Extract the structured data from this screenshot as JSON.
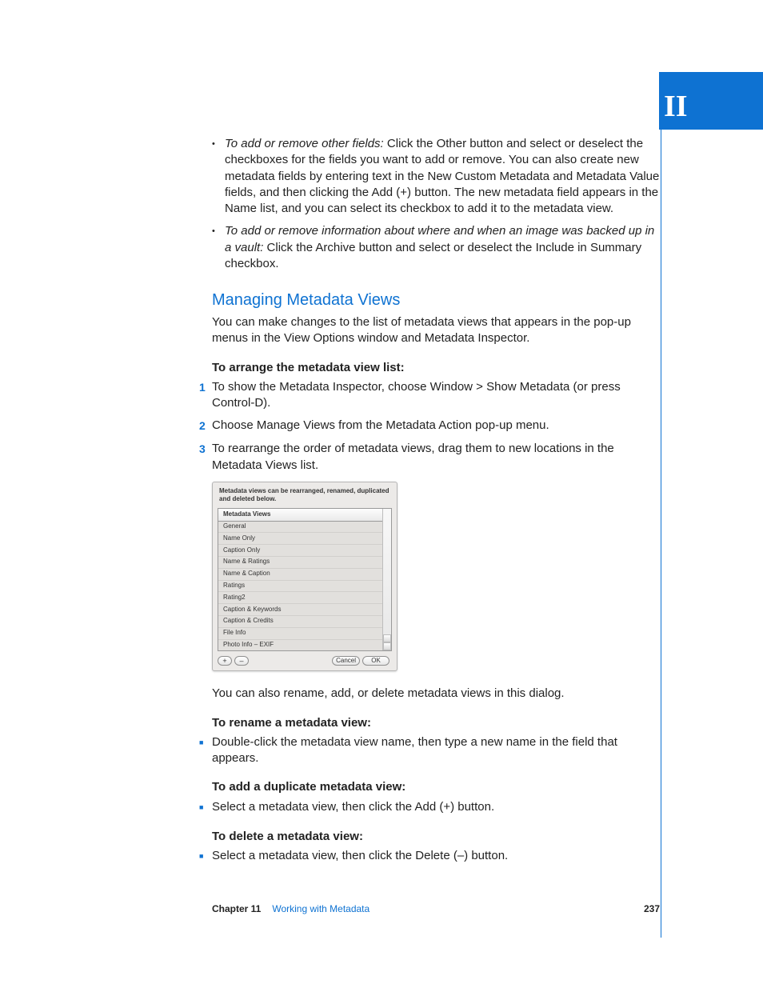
{
  "part_label": "II",
  "bullets_top": [
    {
      "lead": "To add or remove other fields:",
      "rest": " Click the Other button and select or deselect the checkboxes for the fields you want to add or remove. You can also create new metadata fields by entering text in the New Custom Metadata and Metadata Value fields, and then clicking the Add (+) button. The new metadata field appears in the Name list, and you can select its checkbox to add it to the metadata view."
    },
    {
      "lead": "To add or remove information about where and when an image was backed up in a vault:",
      "rest": " Click the Archive button and select or deselect the Include in Summary checkbox."
    }
  ],
  "section_heading": "Managing Metadata Views",
  "section_intro": "You can make changes to the list of metadata views that appears in the pop-up menus in the View Options window and Metadata Inspector.",
  "arrange_heading": "To arrange the metadata view list:",
  "arrange_steps": [
    "To show the Metadata Inspector, choose Window > Show Metadata (or press Control-D).",
    "Choose Manage Views from the Metadata Action pop-up menu.",
    "To rearrange the order of metadata views, drag them to new locations in the Metadata Views list."
  ],
  "dialog": {
    "instruction": "Metadata views can be rearranged, renamed, duplicated and deleted below.",
    "header": "Metadata Views",
    "rows": [
      "General",
      "Name Only",
      "Caption Only",
      "Name & Ratings",
      "Name & Caption",
      "Ratings",
      "Rating2",
      "Caption & Keywords",
      "Caption & Credits",
      "File Info",
      "Photo Info – EXIF"
    ],
    "add_label": "+",
    "remove_label": "–",
    "cancel_label": "Cancel",
    "ok_label": "OK"
  },
  "after_dialog": "You can also rename, add, or delete metadata views in this dialog.",
  "rename_heading": "To rename a metadata view:",
  "rename_item": "Double-click the metadata view name, then type a new name in the field that appears.",
  "duplicate_heading": "To add a duplicate metadata view:",
  "duplicate_item": "Select a metadata view, then click the Add (+) button.",
  "delete_heading": "To delete a metadata view:",
  "delete_item": "Select a metadata view, then click the Delete (–) button.",
  "footer": {
    "chapter": "Chapter 11",
    "title": "Working with Metadata",
    "page": "237"
  }
}
